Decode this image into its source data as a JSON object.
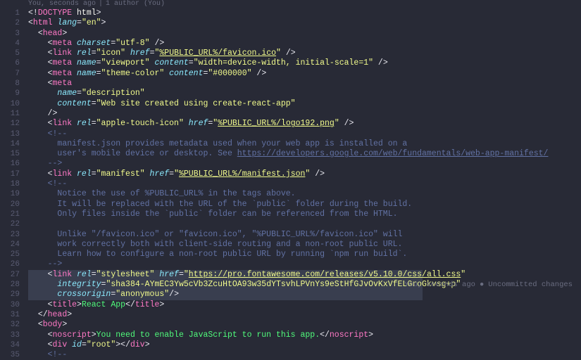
{
  "lens": {
    "left": "You, seconds ago",
    "sep": "|",
    "right": "1 author (You)"
  },
  "blame": {
    "who": "You, seconds ago",
    "bullet": "●",
    "desc": "Uncommitted changes",
    "line_index": 27
  },
  "highlighted_lines": [
    27,
    28,
    29
  ],
  "lines": [
    {
      "n": 1,
      "indent": 0,
      "tokens": [
        [
          "c-punc",
          "<!"
        ],
        [
          "c-tag",
          "DOCTYPE"
        ],
        [
          "c-doctype",
          " html"
        ],
        [
          "c-punc",
          ">"
        ]
      ]
    },
    {
      "n": 2,
      "indent": 0,
      "tokens": [
        [
          "c-punc",
          "<"
        ],
        [
          "c-tag",
          "html"
        ],
        [
          "c-attr",
          " lang"
        ],
        [
          "c-punc",
          "="
        ],
        [
          "c-str",
          "\"en\""
        ],
        [
          "c-punc",
          ">"
        ]
      ]
    },
    {
      "n": 3,
      "indent": 1,
      "tokens": [
        [
          "c-punc",
          "<"
        ],
        [
          "c-tag",
          "head"
        ],
        [
          "c-punc",
          ">"
        ]
      ]
    },
    {
      "n": 4,
      "indent": 2,
      "tokens": [
        [
          "c-punc",
          "<"
        ],
        [
          "c-tag",
          "meta"
        ],
        [
          "c-attr",
          " charset"
        ],
        [
          "c-punc",
          "="
        ],
        [
          "c-str",
          "\"utf-8\""
        ],
        [
          "c-punc",
          " />"
        ]
      ]
    },
    {
      "n": 5,
      "indent": 2,
      "tokens": [
        [
          "c-punc",
          "<"
        ],
        [
          "c-tag",
          "link"
        ],
        [
          "c-attr",
          " rel"
        ],
        [
          "c-punc",
          "="
        ],
        [
          "c-str",
          "\"icon\""
        ],
        [
          "c-attr",
          " href"
        ],
        [
          "c-punc",
          "="
        ],
        [
          "c-str",
          "\""
        ],
        [
          "c-link",
          "%PUBLIC_URL%/favicon.ico"
        ],
        [
          "c-str",
          "\""
        ],
        [
          "c-punc",
          " />"
        ]
      ]
    },
    {
      "n": 6,
      "indent": 2,
      "tokens": [
        [
          "c-punc",
          "<"
        ],
        [
          "c-tag",
          "meta"
        ],
        [
          "c-attr",
          " name"
        ],
        [
          "c-punc",
          "="
        ],
        [
          "c-str",
          "\"viewport\""
        ],
        [
          "c-attr",
          " content"
        ],
        [
          "c-punc",
          "="
        ],
        [
          "c-str",
          "\"width=device-width, initial-scale=1\""
        ],
        [
          "c-punc",
          " />"
        ]
      ]
    },
    {
      "n": 7,
      "indent": 2,
      "tokens": [
        [
          "c-punc",
          "<"
        ],
        [
          "c-tag",
          "meta"
        ],
        [
          "c-attr",
          " name"
        ],
        [
          "c-punc",
          "="
        ],
        [
          "c-str",
          "\"theme-color\""
        ],
        [
          "c-attr",
          " content"
        ],
        [
          "c-punc",
          "="
        ],
        [
          "c-str",
          "\"#000000\""
        ],
        [
          "c-punc",
          " />"
        ]
      ]
    },
    {
      "n": 8,
      "indent": 2,
      "tokens": [
        [
          "c-punc",
          "<"
        ],
        [
          "c-tag",
          "meta"
        ]
      ]
    },
    {
      "n": 9,
      "indent": 3,
      "tokens": [
        [
          "c-attr",
          "name"
        ],
        [
          "c-punc",
          "="
        ],
        [
          "c-str",
          "\"description\""
        ]
      ]
    },
    {
      "n": 10,
      "indent": 3,
      "tokens": [
        [
          "c-attr",
          "content"
        ],
        [
          "c-punc",
          "="
        ],
        [
          "c-str",
          "\"Web site created using create-react-app\""
        ]
      ]
    },
    {
      "n": 11,
      "indent": 2,
      "tokens": [
        [
          "c-punc",
          "/>"
        ]
      ]
    },
    {
      "n": 12,
      "indent": 2,
      "tokens": [
        [
          "c-punc",
          "<"
        ],
        [
          "c-tag",
          "link"
        ],
        [
          "c-attr",
          " rel"
        ],
        [
          "c-punc",
          "="
        ],
        [
          "c-str",
          "\"apple-touch-icon\""
        ],
        [
          "c-attr",
          " href"
        ],
        [
          "c-punc",
          "="
        ],
        [
          "c-str",
          "\""
        ],
        [
          "c-link",
          "%PUBLIC_URL%/logo192.png"
        ],
        [
          "c-str",
          "\""
        ],
        [
          "c-punc",
          " />"
        ]
      ]
    },
    {
      "n": 13,
      "indent": 2,
      "tokens": [
        [
          "c-comment",
          "<!--"
        ]
      ]
    },
    {
      "n": 14,
      "indent": 3,
      "tokens": [
        [
          "c-comment",
          "manifest.json provides metadata used when your web app is installed on a"
        ]
      ]
    },
    {
      "n": 15,
      "indent": 3,
      "tokens": [
        [
          "c-comment",
          "user's mobile device or desktop. See "
        ],
        [
          "c-comment u",
          "https://developers.google.com/web/fundamentals/web-app-manifest/"
        ]
      ]
    },
    {
      "n": 16,
      "indent": 2,
      "tokens": [
        [
          "c-comment",
          "-->"
        ]
      ]
    },
    {
      "n": 17,
      "indent": 2,
      "tokens": [
        [
          "c-punc",
          "<"
        ],
        [
          "c-tag",
          "link"
        ],
        [
          "c-attr",
          " rel"
        ],
        [
          "c-punc",
          "="
        ],
        [
          "c-str",
          "\"manifest\""
        ],
        [
          "c-attr",
          " href"
        ],
        [
          "c-punc",
          "="
        ],
        [
          "c-str",
          "\""
        ],
        [
          "c-link",
          "%PUBLIC_URL%/manifest.json"
        ],
        [
          "c-str",
          "\""
        ],
        [
          "c-punc",
          " />"
        ]
      ]
    },
    {
      "n": 18,
      "indent": 2,
      "tokens": [
        [
          "c-comment",
          "<!--"
        ]
      ]
    },
    {
      "n": 19,
      "indent": 3,
      "tokens": [
        [
          "c-comment",
          "Notice the use of %PUBLIC_URL% in the tags above."
        ]
      ]
    },
    {
      "n": 20,
      "indent": 3,
      "tokens": [
        [
          "c-comment",
          "It will be replaced with the URL of the `public` folder during the build."
        ]
      ]
    },
    {
      "n": 21,
      "indent": 3,
      "tokens": [
        [
          "c-comment",
          "Only files inside the `public` folder can be referenced from the HTML."
        ]
      ]
    },
    {
      "n": 22,
      "indent": 0,
      "tokens": []
    },
    {
      "n": 23,
      "indent": 3,
      "tokens": [
        [
          "c-comment",
          "Unlike \"/favicon.ico\" or \"favicon.ico\", \"%PUBLIC_URL%/favicon.ico\" will"
        ]
      ]
    },
    {
      "n": 24,
      "indent": 3,
      "tokens": [
        [
          "c-comment",
          "work correctly both with client-side routing and a non-root public URL."
        ]
      ]
    },
    {
      "n": 25,
      "indent": 3,
      "tokens": [
        [
          "c-comment",
          "Learn how to configure a non-root public URL by running `npm run build`."
        ]
      ]
    },
    {
      "n": 26,
      "indent": 2,
      "tokens": [
        [
          "c-comment",
          "-->"
        ]
      ]
    },
    {
      "n": 27,
      "indent": 2,
      "tokens": [
        [
          "c-punc",
          "<"
        ],
        [
          "c-tag",
          "link"
        ],
        [
          "c-attr",
          " rel"
        ],
        [
          "c-punc",
          "="
        ],
        [
          "c-str",
          "\"stylesheet\""
        ],
        [
          "c-attr",
          " href"
        ],
        [
          "c-punc",
          "="
        ],
        [
          "c-str",
          "\""
        ],
        [
          "c-link",
          "https://pro.fontawesome.com/releases/v5.10.0/css/all.css"
        ],
        [
          "c-str",
          "\""
        ]
      ]
    },
    {
      "n": 28,
      "indent": 3,
      "tokens": [
        [
          "c-attr",
          "integrity"
        ],
        [
          "c-punc",
          "="
        ],
        [
          "c-str",
          "\"sha384-AYmEC3Yw5cVb3ZcuHtOA93w35dYTsvhLPVnYs9eStHfGJvOvKxVfELGroGkvsg+p\""
        ]
      ]
    },
    {
      "n": 29,
      "indent": 3,
      "tokens": [
        [
          "c-attr",
          "crossorigin"
        ],
        [
          "c-punc",
          "="
        ],
        [
          "c-str",
          "\"anonymous\""
        ],
        [
          "c-punc",
          "/>"
        ]
      ]
    },
    {
      "n": 30,
      "indent": 2,
      "tokens": [
        [
          "c-punc",
          "<"
        ],
        [
          "c-tag",
          "title"
        ],
        [
          "c-punc",
          ">"
        ],
        [
          "c-ent",
          "React App"
        ],
        [
          "c-punc",
          "</"
        ],
        [
          "c-tag",
          "title"
        ],
        [
          "c-punc",
          ">"
        ]
      ]
    },
    {
      "n": 31,
      "indent": 1,
      "tokens": [
        [
          "c-punc",
          "</"
        ],
        [
          "c-tag",
          "head"
        ],
        [
          "c-punc",
          ">"
        ]
      ]
    },
    {
      "n": 32,
      "indent": 1,
      "tokens": [
        [
          "c-punc",
          "<"
        ],
        [
          "c-tag",
          "body"
        ],
        [
          "c-punc",
          ">"
        ]
      ]
    },
    {
      "n": 33,
      "indent": 2,
      "tokens": [
        [
          "c-punc",
          "<"
        ],
        [
          "c-tag",
          "noscript"
        ],
        [
          "c-punc",
          ">"
        ],
        [
          "c-ent",
          "You need to enable JavaScript to run this app."
        ],
        [
          "c-punc",
          "</"
        ],
        [
          "c-tag",
          "noscript"
        ],
        [
          "c-punc",
          ">"
        ]
      ]
    },
    {
      "n": 34,
      "indent": 2,
      "tokens": [
        [
          "c-punc",
          "<"
        ],
        [
          "c-tag",
          "div"
        ],
        [
          "c-attr",
          " id"
        ],
        [
          "c-punc",
          "="
        ],
        [
          "c-str",
          "\"root\""
        ],
        [
          "c-punc",
          "></"
        ],
        [
          "c-tag",
          "div"
        ],
        [
          "c-punc",
          ">"
        ]
      ]
    },
    {
      "n": 35,
      "indent": 2,
      "tokens": [
        [
          "c-comment",
          "<!--"
        ]
      ]
    }
  ]
}
